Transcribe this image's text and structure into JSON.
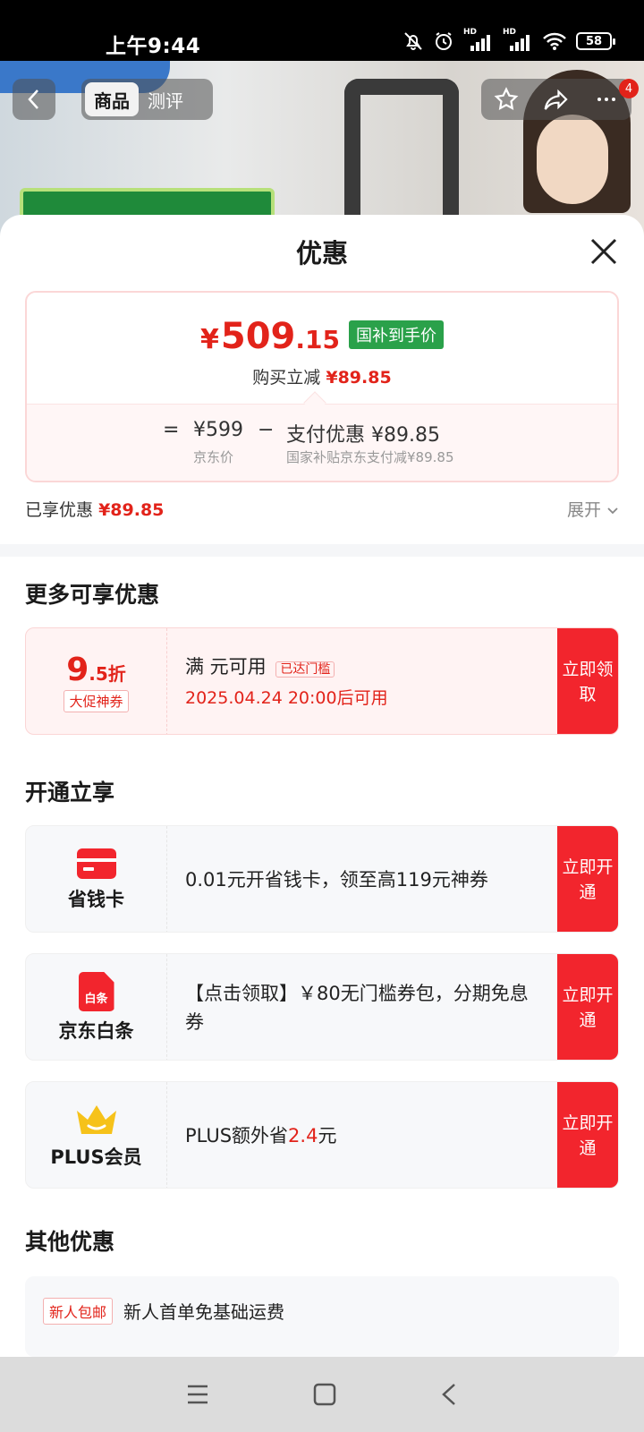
{
  "status_bar": {
    "time": "上午9:44",
    "battery": "58"
  },
  "product_nav": {
    "tabs": [
      "商品",
      "测评"
    ],
    "badge_count": "4"
  },
  "sheet": {
    "title": "优惠",
    "price_card": {
      "currency": "¥",
      "price_int": "509",
      "price_dec": ".15",
      "price_tag": "国补到手价",
      "instant_cut_label": "购买立减",
      "instant_cut_value": "¥89.85",
      "equals": "=",
      "jd_price": "¥599",
      "jd_price_label": "京东价",
      "minus": "−",
      "pay_discount": "支付优惠 ¥89.85",
      "pay_discount_desc": "国家补贴京东支付减¥89.85"
    },
    "enjoyed": {
      "label": "已享优惠",
      "value": "¥89.85"
    },
    "expand_label": "展开",
    "more_section": {
      "title": "更多可享优惠",
      "coupon": {
        "discount_big": "9",
        "discount_small": ".5折",
        "badge": "大促神券",
        "line1": "满 元可用",
        "overlay_tag": "已达门槛",
        "line2": "2025.04.24 20:00后可用",
        "button": "立即领取"
      }
    },
    "open_section": {
      "title": "开通立享",
      "items": [
        {
          "label": "省钱卡",
          "text": "0.01元开省钱卡，领至高119元神券",
          "button": "立即开通",
          "icon": "money-card-icon"
        },
        {
          "label": "京东白条",
          "text": "【点击领取】￥80无门槛券包，分期免息券",
          "button": "立即开通",
          "icon": "baitiao-icon",
          "icon_text": "白条"
        },
        {
          "label": "PLUS会员",
          "text_prefix": "PLUS额外省",
          "text_highlight": "2.4",
          "text_suffix": "元",
          "button": "立即开通",
          "icon": "crown-icon"
        }
      ]
    },
    "other_section": {
      "title": "其他优惠",
      "tag": "新人包邮",
      "text": "新人首单免基础运费"
    }
  },
  "colors": {
    "accent": "#e2231a",
    "button": "#f2252d",
    "green_tag": "#2aa14a"
  }
}
